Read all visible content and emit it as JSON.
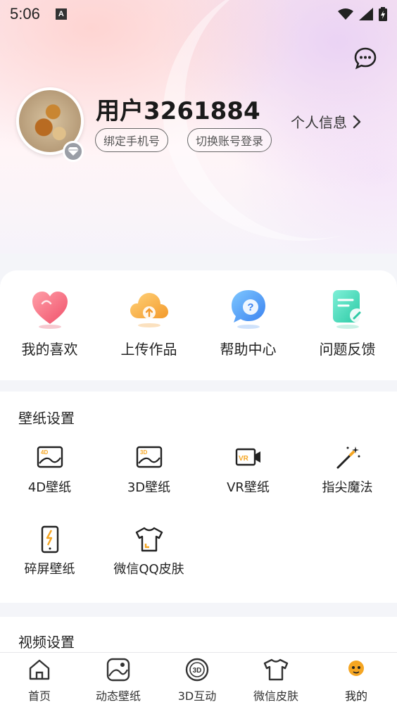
{
  "status_bar": {
    "time": "5:06",
    "app_badge": "A"
  },
  "profile": {
    "username": "用户3261884",
    "bind_phone_label": "绑定手机号",
    "switch_account_label": "切换账号登录",
    "personal_info_label": "个人信息"
  },
  "quick_actions": [
    {
      "label": "我的喜欢",
      "icon": "heart-icon"
    },
    {
      "label": "上传作品",
      "icon": "cloud-upload-icon"
    },
    {
      "label": "帮助中心",
      "icon": "help-bubble-icon"
    },
    {
      "label": "问题反馈",
      "icon": "feedback-doc-icon"
    }
  ],
  "wallpaper_settings": {
    "title": "壁纸设置",
    "items": [
      {
        "label": "4D壁纸",
        "icon": "4d-wallpaper-icon"
      },
      {
        "label": "3D壁纸",
        "icon": "3d-wallpaper-icon"
      },
      {
        "label": "VR壁纸",
        "icon": "vr-wallpaper-icon"
      },
      {
        "label": "指尖魔法",
        "icon": "magic-wand-icon"
      },
      {
        "label": "碎屏壁纸",
        "icon": "broken-screen-icon"
      },
      {
        "label": "微信QQ皮肤",
        "icon": "tshirt-skin-icon"
      }
    ]
  },
  "video_settings": {
    "title": "视频设置"
  },
  "tabbar": {
    "items": [
      {
        "label": "首页",
        "icon": "home-icon"
      },
      {
        "label": "动态壁纸",
        "icon": "live-wallpaper-icon"
      },
      {
        "label": "3D互动",
        "icon": "3d-interactive-icon"
      },
      {
        "label": "微信皮肤",
        "icon": "tshirt-icon"
      },
      {
        "label": "我的",
        "icon": "mine-icon"
      }
    ]
  },
  "colors": {
    "accent_orange": "#f5a623",
    "text_dark": "#222222",
    "card_bg": "#ffffff",
    "page_bg": "#f4f5f9"
  }
}
